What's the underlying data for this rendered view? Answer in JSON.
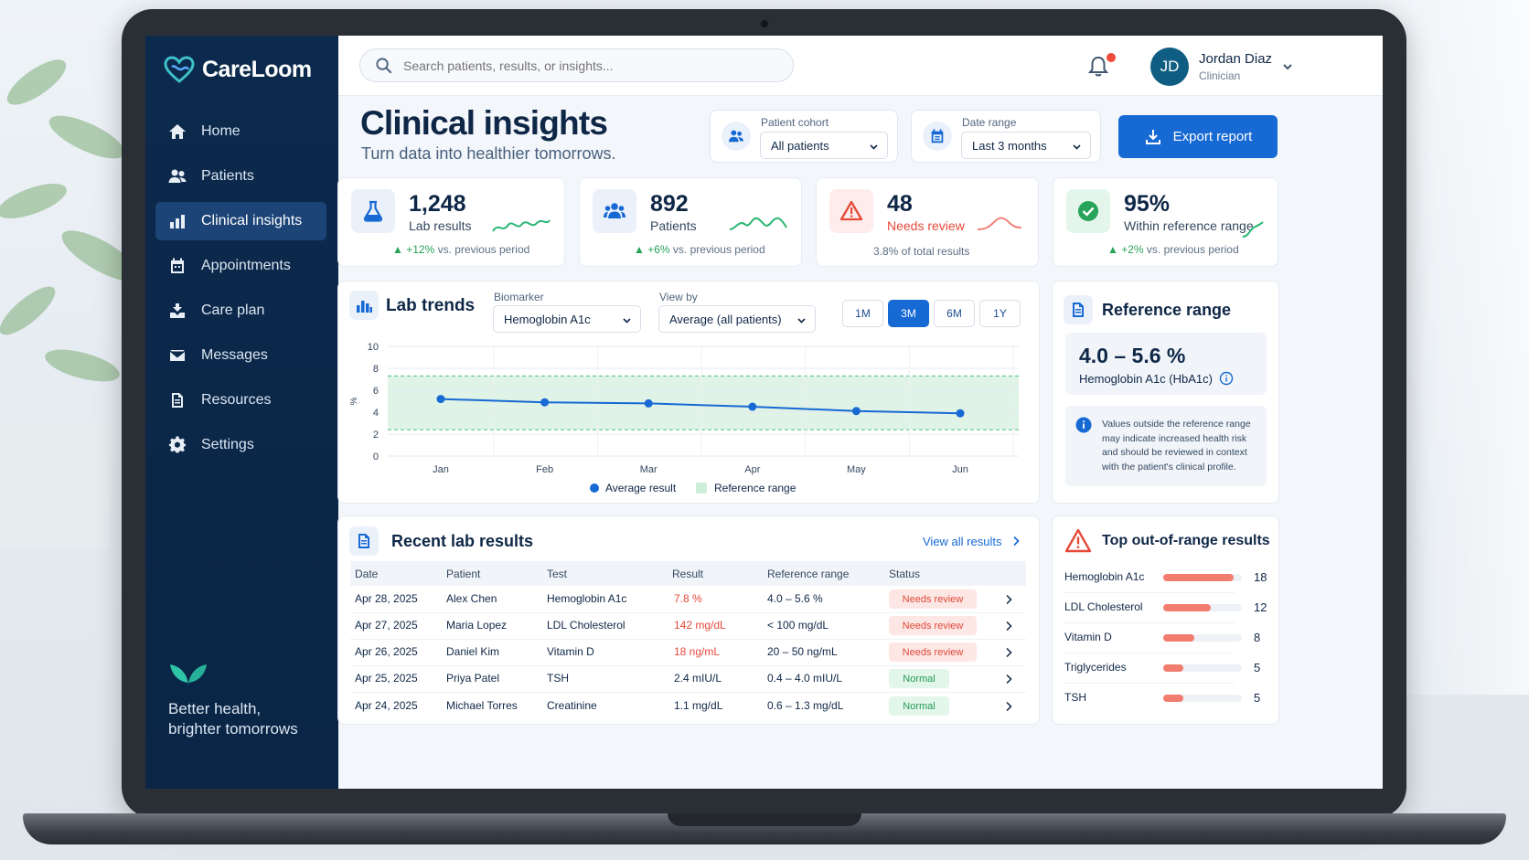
{
  "brand": {
    "name": "CareLoom"
  },
  "sidebar": {
    "items": [
      {
        "label": "Home",
        "icon": "home-icon",
        "active": false
      },
      {
        "label": "Patients",
        "icon": "users-icon",
        "active": false
      },
      {
        "label": "Clinical insights",
        "icon": "bar-chart-icon",
        "active": true
      },
      {
        "label": "Appointments",
        "icon": "calendar-icon",
        "active": false
      },
      {
        "label": "Care plan",
        "icon": "care-plan-icon",
        "active": false
      },
      {
        "label": "Messages",
        "icon": "envelope-icon",
        "active": false
      },
      {
        "label": "Resources",
        "icon": "document-icon",
        "active": false
      },
      {
        "label": "Settings",
        "icon": "gear-icon",
        "active": false
      }
    ],
    "tagline": "Better health, brighter tomorrows"
  },
  "topbar": {
    "search_placeholder": "Search patients, results, or insights...",
    "user": {
      "initials": "JD",
      "name": "Jordan Diaz",
      "role": "Clinician"
    }
  },
  "header": {
    "title": "Clinical insights",
    "subtitle": "Turn data into healthier tomorrows.",
    "cohort": {
      "label": "Patient cohort",
      "value": "All patients"
    },
    "date_range": {
      "label": "Date range",
      "value": "Last 3 months"
    },
    "export_label": "Export report"
  },
  "kpis": [
    {
      "value": "1,248",
      "label": "Lab results",
      "delta_value": "+12%",
      "delta_rest": " vs. previous period",
      "color": "#1769d4"
    },
    {
      "value": "892",
      "label": "Patients",
      "delta_value": "+6%",
      "delta_rest": " vs. previous period",
      "color": "#1769d4"
    },
    {
      "value": "48",
      "label": "Needs review",
      "note": "3.8% of total results",
      "color": "#e6493a"
    },
    {
      "value": "95%",
      "label": "Within reference range",
      "delta_value": "+2%",
      "delta_rest": " vs. previous period",
      "color": "#27a35a"
    }
  ],
  "lab_trends": {
    "title": "Lab trends",
    "biomarker_label": "Biomarker",
    "biomarker_value": "Hemoglobin A1c",
    "view_label": "View by",
    "view_value": "Average (all patients)",
    "ranges": [
      "1M",
      "3M",
      "6M",
      "1Y"
    ],
    "active_range": "3M",
    "y_unit": "%",
    "legend": {
      "series": "Average result",
      "band": "Reference range"
    }
  },
  "chart_data": {
    "type": "line",
    "categories": [
      "Jan",
      "Feb",
      "Mar",
      "Apr",
      "May",
      "Jun"
    ],
    "series": [
      {
        "name": "Average result",
        "values": [
          5.2,
          4.9,
          4.8,
          4.5,
          4.1,
          3.9
        ]
      }
    ],
    "reference_band": [
      2.4,
      7.3
    ],
    "ylabel": "%",
    "ylim": [
      0,
      10
    ],
    "yticks": [
      0,
      2,
      4,
      6,
      8,
      10
    ],
    "grid": true,
    "legend_position": "bottom"
  },
  "reference_range": {
    "title": "Reference range",
    "value": "4.0 – 5.6 %",
    "test": "Hemoglobin A1c (HbA1c)",
    "note": "Values outside the reference range may indicate increased health risk and should be reviewed in context with the patient's clinical profile."
  },
  "recent_results": {
    "title": "Recent lab results",
    "view_all": "View all results",
    "columns": [
      "Date",
      "Patient",
      "Test",
      "Result",
      "Reference range",
      "Status"
    ],
    "rows": [
      {
        "date": "Apr 28, 2025",
        "patient": "Alex Chen",
        "test": "Hemoglobin A1c",
        "result": "7.8 %",
        "range": "4.0 – 5.6 %",
        "status": "Needs review",
        "flag": "review"
      },
      {
        "date": "Apr 27, 2025",
        "patient": "Maria Lopez",
        "test": "LDL Cholesterol",
        "result": "142 mg/dL",
        "range": "< 100 mg/dL",
        "status": "Needs review",
        "flag": "review"
      },
      {
        "date": "Apr 26, 2025",
        "patient": "Daniel Kim",
        "test": "Vitamin D",
        "result": "18 ng/mL",
        "range": "20 – 50 ng/mL",
        "status": "Needs review",
        "flag": "review"
      },
      {
        "date": "Apr 25, 2025",
        "patient": "Priya Patel",
        "test": "TSH",
        "result": "2.4 mIU/L",
        "range": "0.4 – 4.0 mIU/L",
        "status": "Normal",
        "flag": "normal"
      },
      {
        "date": "Apr 24, 2025",
        "patient": "Michael Torres",
        "test": "Creatinine",
        "result": "1.1 mg/dL",
        "range": "0.6 – 1.3 mg/dL",
        "status": "Normal",
        "flag": "normal"
      }
    ]
  },
  "out_of_range": {
    "title": "Top out-of-range results",
    "max": 20,
    "items": [
      {
        "label": "Hemoglobin A1c",
        "count": 18
      },
      {
        "label": "LDL Cholesterol",
        "count": 12
      },
      {
        "label": "Vitamin D",
        "count": 8
      },
      {
        "label": "Triglycerides",
        "count": 5
      },
      {
        "label": "TSH",
        "count": 5
      }
    ]
  }
}
